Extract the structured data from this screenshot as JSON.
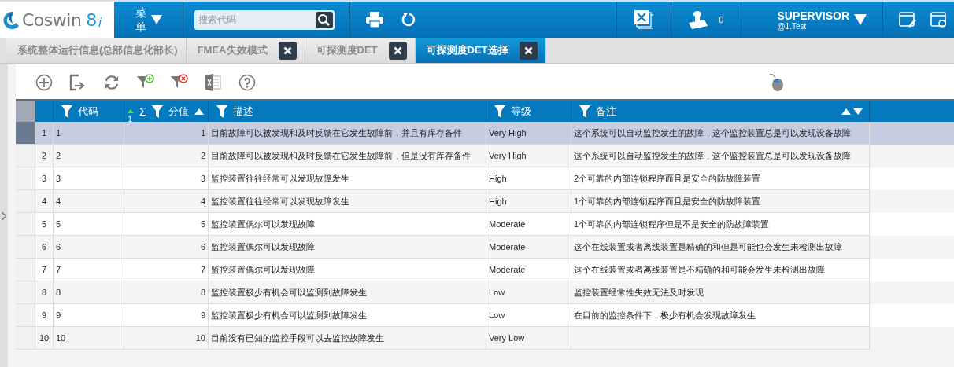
{
  "header": {
    "logo": {
      "name": "Coswin",
      "version": "8",
      "suffix": "i"
    },
    "menu_label": "菜单",
    "search": {
      "placeholder": "搜索代码"
    },
    "notification_count": "0",
    "user": {
      "name": "SUPERVISOR",
      "site": "@1.Test"
    }
  },
  "tabs": [
    {
      "label": "系统整体运行信息(总部信息化部长)",
      "selected": false,
      "closable": false
    },
    {
      "label": "FMEA失效模式",
      "selected": false,
      "closable": true
    },
    {
      "label": "可探测度DET",
      "selected": false,
      "closable": true
    },
    {
      "label": "可探测度DET选择",
      "selected": true,
      "closable": true
    }
  ],
  "table": {
    "columns": [
      {
        "label": "代码",
        "kind": "text"
      },
      {
        "label": "分值",
        "kind": "sum",
        "sum_symbol": "Σ",
        "sort_index": "1"
      },
      {
        "label": "描述",
        "kind": "text"
      },
      {
        "label": "等级",
        "kind": "text"
      },
      {
        "label": "备注",
        "kind": "sortable"
      }
    ],
    "rows": [
      {
        "number": "1",
        "selected": true,
        "cells": [
          "1",
          "1",
          "目前故障可以被发现和及时反馈在它发生故障前，并且有库存备件",
          "Very High",
          "这个系统可以自动监控发生的故障，这个监控装置总是可以发现设备故障"
        ]
      },
      {
        "number": "2",
        "selected": false,
        "cells": [
          "2",
          "2",
          "目前故障可以被发现和及时反馈在它发生故障前，但是没有库存备件",
          "Very High",
          "这个系统可以自动监控发生的故障，这个监控装置总是可以发现设备故障"
        ]
      },
      {
        "number": "3",
        "selected": false,
        "cells": [
          "3",
          "3",
          "监控装置往往经常可以发现故障发生",
          "High",
          "2个可靠的内部连锁程序而且是安全的防故障装置"
        ]
      },
      {
        "number": "4",
        "selected": false,
        "cells": [
          "4",
          "4",
          "监控装置往往经常可以发现故障发生",
          "High",
          "1个可靠的内部连锁程序而且是安全的防故障装置"
        ]
      },
      {
        "number": "5",
        "selected": false,
        "cells": [
          "5",
          "5",
          "监控装置偶尔可以发现故障",
          "Moderate",
          "1个可靠的内部连锁程序但是不是安全的防故障装置"
        ]
      },
      {
        "number": "6",
        "selected": false,
        "cells": [
          "6",
          "6",
          "监控装置偶尔可以发现故障",
          "Moderate",
          "这个在线装置或者离线装置是精确的和但是可能也会发生未检测出故障"
        ]
      },
      {
        "number": "7",
        "selected": false,
        "cells": [
          "7",
          "7",
          "监控装置偶尔可以发现故障",
          "Moderate",
          "这个在线装置或者离线装置是不精确的和可能会发生未检测出故障"
        ]
      },
      {
        "number": "8",
        "selected": false,
        "cells": [
          "8",
          "8",
          "监控装置极少有机会可以监测到故障发生",
          "Low",
          "监控装置经常性失效无法及时发现"
        ]
      },
      {
        "number": "9",
        "selected": false,
        "cells": [
          "9",
          "9",
          "监控装置极少有机会可以监测到故障发生",
          "Low",
          "在目前的监控条件下，极少有机会发现故障发生"
        ]
      },
      {
        "number": "10",
        "selected": false,
        "cells": [
          "10",
          "10",
          "目前没有已知的监控手段可以去监控故障发生",
          "Very Low",
          ""
        ]
      }
    ]
  }
}
